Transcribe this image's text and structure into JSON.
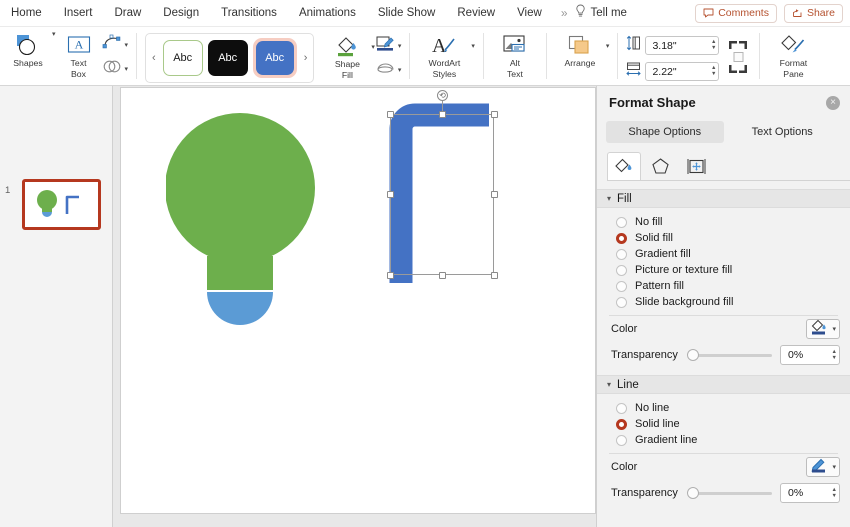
{
  "menubar": {
    "items": [
      {
        "label": "Home"
      },
      {
        "label": "Insert"
      },
      {
        "label": "Draw"
      },
      {
        "label": "Design"
      },
      {
        "label": "Transitions"
      },
      {
        "label": "Animations"
      },
      {
        "label": "Slide Show"
      },
      {
        "label": "Review"
      },
      {
        "label": "View"
      }
    ],
    "overflow": "»",
    "tell_me": "Tell me",
    "tell_me_icon": "lightbulb-icon",
    "comments_label": "Comments",
    "share_label": "Share"
  },
  "ribbon": {
    "shapes_label": "Shapes",
    "textbox_label_line1": "Text",
    "textbox_label_line2": "Box",
    "gallery": {
      "prev_arrow": "‹",
      "next_arrow": "›",
      "thumbs": [
        {
          "text": "Abc",
          "style": "outline-green"
        },
        {
          "text": "Abc",
          "style": "black"
        },
        {
          "text": "Abc",
          "style": "blue",
          "selected": true
        }
      ]
    },
    "shape_fill_label_line1": "Shape",
    "shape_fill_label_line2": "Fill",
    "wordart_label_line1": "WordArt",
    "wordart_label_line2": "Styles",
    "alttext_label_line1": "Alt",
    "alttext_label_line2": "Text",
    "arrange_label": "Arrange",
    "height_value": "3.18\"",
    "width_value": "2.22\"",
    "height_placeholder": "Height",
    "width_placeholder": "Width",
    "format_pane_label_line1": "Format",
    "format_pane_label_line2": "Pane"
  },
  "slides": {
    "thumbnails": [
      {
        "number": "1",
        "selected": true
      }
    ]
  },
  "canvas": {
    "shapes": [
      {
        "name": "lightbulb-shape",
        "bulb_color": "#6DAF4C",
        "base_color": "#5B9BD5"
      },
      {
        "name": "rounded-rect-outline-shape",
        "stroke_color": "#4472C4",
        "selected": true
      }
    ]
  },
  "format_pane": {
    "title": "Format Shape",
    "close_icon": "×",
    "tabs": [
      {
        "label": "Shape Options",
        "active": true
      },
      {
        "label": "Text Options",
        "active": false
      }
    ],
    "icon_tabs": [
      {
        "name": "fill-and-line-icon",
        "active": true
      },
      {
        "name": "effects-pentagon-icon",
        "active": false
      },
      {
        "name": "size-properties-icon",
        "active": false
      }
    ],
    "fill": {
      "section_label": "Fill",
      "expanded": true,
      "options": [
        {
          "label": "No fill",
          "selected": false
        },
        {
          "label": "Solid fill",
          "selected": true
        },
        {
          "label": "Gradient fill",
          "selected": false
        },
        {
          "label": "Picture or texture fill",
          "selected": false
        },
        {
          "label": "Pattern fill",
          "selected": false
        },
        {
          "label": "Slide background fill",
          "selected": false
        }
      ],
      "color_label": "Color",
      "color_swatch": "#2E4D8E",
      "transparency_label": "Transparency",
      "transparency_value": "0%"
    },
    "line": {
      "section_label": "Line",
      "expanded": true,
      "options": [
        {
          "label": "No line",
          "selected": false
        },
        {
          "label": "Solid line",
          "selected": true
        },
        {
          "label": "Gradient line",
          "selected": false
        }
      ],
      "color_label": "Color",
      "color_swatch": "#2E4D8E",
      "transparency_label": "Transparency",
      "transparency_value": "0%"
    },
    "accent_color": "#B5381F"
  }
}
